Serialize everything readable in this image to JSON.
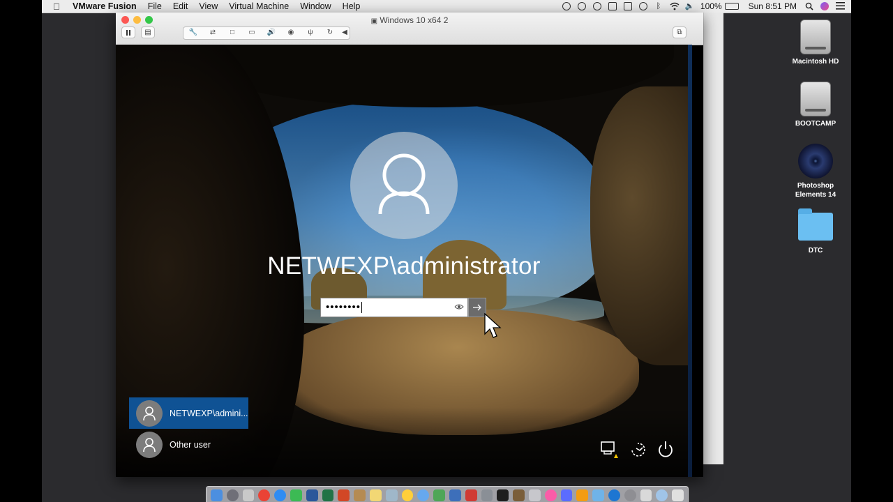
{
  "menubar": {
    "app_name": "VMware Fusion",
    "menus": [
      "File",
      "Edit",
      "View",
      "Virtual Machine",
      "Window",
      "Help"
    ],
    "battery": "100%",
    "clock": "Sun 8:51 PM"
  },
  "desktop_icons": [
    {
      "label": "Macintosh HD",
      "type": "drive"
    },
    {
      "label": "BOOTCAMP",
      "type": "drive"
    },
    {
      "label": "Photoshop Elements 14",
      "type": "disc"
    },
    {
      "label": "DTC",
      "type": "folder"
    }
  ],
  "vm_window": {
    "title": "Windows 10 x64 2"
  },
  "login": {
    "username": "NETWEXP\\administrator",
    "password_mask": "••••••••",
    "users": [
      {
        "label": "NETWEXP\\admini...",
        "selected": true
      },
      {
        "label": "Other user",
        "selected": false
      }
    ]
  },
  "colors": {
    "accent_selected": "#0f5294",
    "close_light": "#fc5753",
    "minimize_light": "#fdbc40",
    "zoom_light": "#33c748"
  }
}
